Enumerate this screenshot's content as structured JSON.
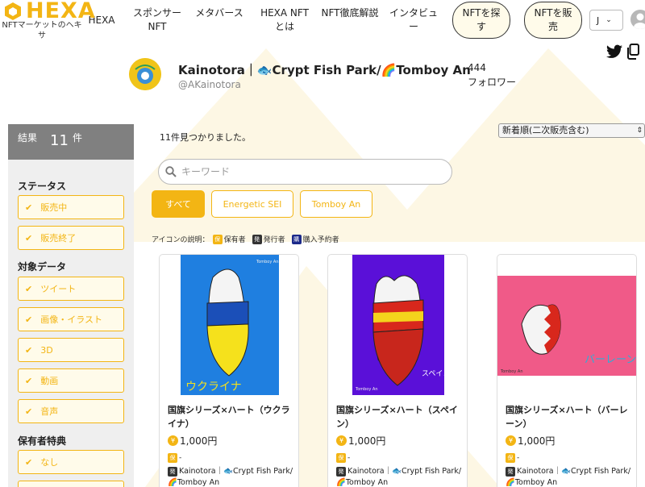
{
  "header": {
    "logo_text": "HEXA",
    "logo_sub": "NFTマーケットのヘキサ",
    "nav": [
      {
        "label": "HEXA"
      },
      {
        "label": "スポンサーNFT"
      },
      {
        "label": "メタバース"
      },
      {
        "label": "HEXA NFTとは"
      },
      {
        "label": "NFT徹底解説"
      },
      {
        "label": "インタビュー"
      }
    ],
    "buy_button": "NFTを探す",
    "sell_button": "NFTを販売",
    "language": "J"
  },
  "profile": {
    "name": "Kainotora｜🐟Crypt Fish Park/🌈Tomboy An",
    "handle": "@AKainotora",
    "follower_count": "444",
    "follower_label": "フォロワー"
  },
  "sidebar": {
    "results_label": "結果",
    "results_count": "11",
    "results_unit": "件",
    "sections": [
      {
        "title": "ステータス",
        "items": [
          "販売中",
          "販売終了"
        ]
      },
      {
        "title": "対象データ",
        "items": [
          "ツイート",
          "画像・イラスト",
          "3D",
          "動画",
          "音声"
        ]
      },
      {
        "title": "保有者特典",
        "items": [
          "なし"
        ]
      }
    ]
  },
  "main": {
    "found_text": "11件見つかりました。",
    "sort_selected": "新着順(二次販売含む)",
    "search_placeholder": "キーワード",
    "tags": [
      "すべて",
      "Energetic SEI",
      "Tomboy An"
    ],
    "legend": {
      "label": "アイコンの説明：",
      "items": [
        {
          "badge": "保",
          "text": "保有者"
        },
        {
          "badge": "発",
          "text": "発行者"
        },
        {
          "badge": "購",
          "text": "購入予約者"
        }
      ]
    }
  },
  "cards": [
    {
      "title": "国旗シリーズ×ハート（ウクライナ）",
      "price": "1,000円",
      "holder": "-",
      "issuer": "Kainotora｜🐟Crypt Fish Park/🌈Tomboy An",
      "art_caption": "Tomboy An",
      "art_text": "ウクライナ"
    },
    {
      "title": "国旗シリーズ×ハート（スペイン）",
      "price": "1,000円",
      "holder": "-",
      "issuer": "Kainotora｜🐟Crypt Fish Park/🌈Tomboy An",
      "art_caption": "Tomboy An",
      "art_text": "スペイン"
    },
    {
      "title": "国旗シリーズ×ハート（バーレーン）",
      "price": "1,000円",
      "holder": "-",
      "issuer": "Kainotora｜🐟Crypt Fish Park/🌈Tomboy An",
      "art_caption": "Tomboy An",
      "art_text": "バーレーン"
    }
  ],
  "badges": {
    "holder": "保",
    "issuer": "発",
    "coin": "¥"
  },
  "colors": {
    "accent": "#f3b514",
    "sidebar_head": "#808080",
    "sidebar_bg": "#efefef"
  },
  "icons": [
    "hexa-logo-icon",
    "search-icon",
    "twitter-icon",
    "copy-icon",
    "user-icon",
    "check-icon",
    "chevron-down-icon"
  ]
}
